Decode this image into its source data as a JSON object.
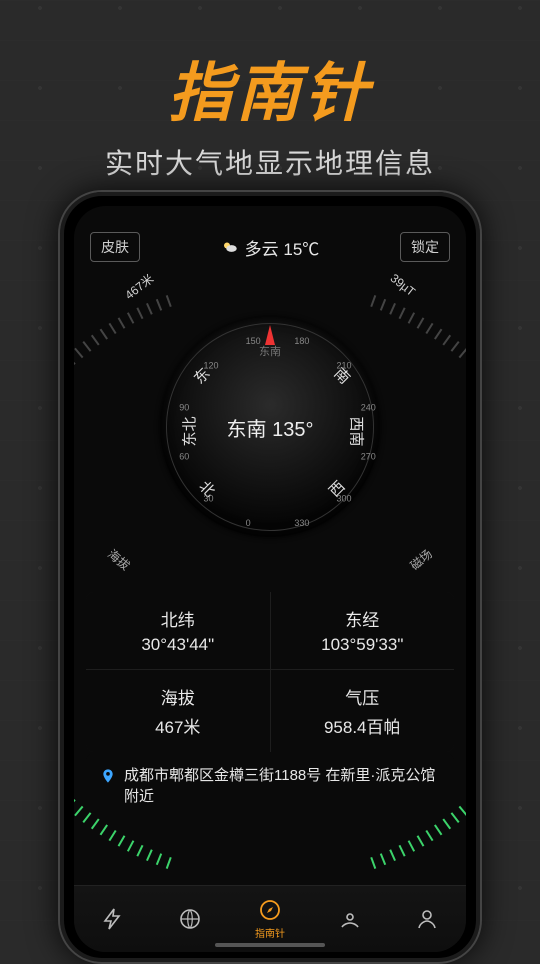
{
  "hero": {
    "title": "指南针",
    "subtitle": "实时大气地显示地理信息"
  },
  "topbar": {
    "skin": "皮肤",
    "lock": "锁定",
    "weather": "多云 15℃"
  },
  "compass": {
    "heading": "东南 135°",
    "heading_sub": "东南",
    "altitude_word": "海拔",
    "altitude_val": "467米",
    "mag_word": "磁场",
    "mag_val": "39µT",
    "cardinals": {
      "N": "北",
      "NE": "东",
      "E": "东",
      "SE": "南",
      "S": "南",
      "SW": "西南",
      "W": "西",
      "NW": "西"
    }
  },
  "grid": {
    "lat_label": "北纬",
    "lat": "30°43'44\"",
    "lon_label": "东经",
    "lon": "103°59'33\"",
    "alt_label": "海拔",
    "alt": "467米",
    "press_label": "气压",
    "press": "958.4百帕"
  },
  "address": "成都市郫都区金樽三街1188号 在新里·派克公馆附近",
  "nav": {
    "active_label": "指南针",
    "items": [
      "",
      "",
      "指南针",
      "",
      ""
    ]
  }
}
